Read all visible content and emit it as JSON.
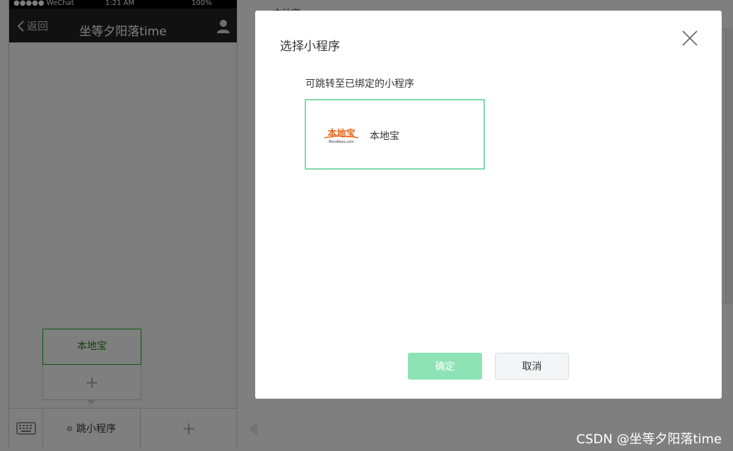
{
  "background": {
    "top_text": "本地宝",
    "phone": {
      "status": {
        "carrier": "●●●●● WeChat",
        "time": "1:21 AM",
        "battery": "100%"
      },
      "nav": {
        "back_label": "返回",
        "title": "坐等夕阳落time"
      },
      "chat_bubble_label": "本地宝",
      "add_box_symbol": "+",
      "menu": {
        "item1_label": "跳小程序",
        "item2_symbol": "+"
      }
    }
  },
  "dialog": {
    "title": "选择小程序",
    "hint": "可跳转至已绑定的小程序",
    "mini_programs": [
      {
        "name": "本地宝",
        "logo_text": "本地宝",
        "logo_subtext": "Bendibao.com",
        "selected": true
      }
    ],
    "ok_label": "确定",
    "cancel_label": "取消",
    "colors": {
      "ok_button": "#8ee3b5",
      "card_border": "#7ed9ab"
    }
  },
  "icons": [
    "back-chevron-icon",
    "user-icon",
    "keyboard-icon",
    "close-icon",
    "bendibao-logo"
  ],
  "watermark": "CSDN @坐等夕阳落time"
}
